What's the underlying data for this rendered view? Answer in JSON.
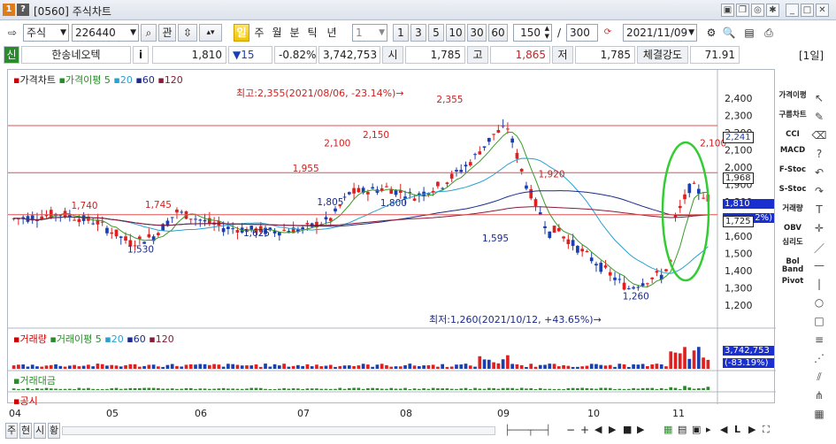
{
  "window": {
    "code": "[0560]",
    "title": "주식차트"
  },
  "titlebar_icons": [
    "pin-icon",
    "copy-icon",
    "camera-icon",
    "settings-icon",
    "minimize-icon",
    "maximize-icon",
    "close-icon"
  ],
  "toolbar": {
    "market": "주식",
    "code": "226440",
    "search_icon": "search-icon",
    "favorite_label": "관",
    "periods": [
      "일",
      "주",
      "월",
      "분",
      "틱",
      "년"
    ],
    "active_period": "일",
    "interval_value": "1",
    "interval_presets": [
      "1",
      "3",
      "5",
      "10",
      "30",
      "60"
    ],
    "count_value": "150",
    "slash": "/",
    "total_value": "300",
    "date_value": "2021/11/09"
  },
  "info": {
    "credit": "신",
    "stock_name": "한송네오텍",
    "info_icon": "i",
    "price": "1,810",
    "change": "▼15",
    "change_pct": "-0.82%",
    "volume": "3,742,753",
    "open_label": "시",
    "open": "1,785",
    "high_label": "고",
    "high": "1,865",
    "low_label": "저",
    "low": "1,785",
    "strength_label": "체결강도",
    "strength": "71.91",
    "period_badge": "[1일]"
  },
  "price_panel": {
    "title": "가격차트",
    "ma_title": "가격이평",
    "ma_periods": [
      "5",
      "20",
      "60",
      "120"
    ],
    "max_note": "최고:2,355(2021/08/06, -23.14%)→",
    "min_note": "최저:1,260(2021/10/12, +43.65%)→",
    "current_price_tag": "1,810",
    "current_pct_tag": "2%)",
    "line_tag_1": "2,241",
    "line_tag_2": "1,968",
    "line_tag_3": "1,725"
  },
  "volume_panel": {
    "title": "거래량",
    "ma_title": "거래이평",
    "ma_periods": [
      "5",
      "20",
      "60",
      "120"
    ],
    "value": "3,742,753",
    "pct": "(-83.19%)"
  },
  "amount_panel": {
    "title": "거래대금"
  },
  "notice_panel": {
    "title": "공시"
  },
  "x_axis": [
    "04",
    "05",
    "06",
    "07",
    "08",
    "09",
    "10",
    "11"
  ],
  "y_axis": [
    "2,400",
    "2,300",
    "2,200",
    "2,100",
    "2,000",
    "1,900",
    "1,800",
    "1,700",
    "1,600",
    "1,500",
    "1,400",
    "1,300",
    "1,200"
  ],
  "sidebar_indicators": [
    "가격이평",
    "구름차트",
    "CCI",
    "MACD",
    "F-Stoc",
    "S-Stoc",
    "거래량",
    "OBV",
    "심리도",
    "Bol Band",
    "Pivot"
  ],
  "bottom_tabs": [
    "주",
    "현",
    "시",
    "황"
  ],
  "chart_data": {
    "type": "candlestick",
    "annotations": [
      {
        "label": "1,740",
        "x": "04"
      },
      {
        "label": "1,745",
        "x": "05"
      },
      {
        "label": "1,530",
        "x": "05"
      },
      {
        "label": "1,625",
        "x": "06"
      },
      {
        "label": "1,955",
        "x": "07"
      },
      {
        "label": "2,100",
        "x": "07"
      },
      {
        "label": "1,805",
        "x": "07"
      },
      {
        "label": "2,150",
        "x": "07"
      },
      {
        "label": "1,800",
        "x": "08"
      },
      {
        "label": "2,355",
        "x": "08"
      },
      {
        "label": "1,595",
        "x": "08"
      },
      {
        "label": "1,920",
        "x": "09"
      },
      {
        "label": "1,260",
        "x": "10"
      },
      {
        "label": "2,100",
        "x": "11"
      }
    ],
    "ylim": [
      1150,
      2420
    ],
    "colors": {
      "up": "#e02020",
      "down": "#1a3fb0",
      "ma5": "#3a9a2a",
      "ma20": "#2aa0d0",
      "ma60": "#1a2a8a",
      "ma120": "#8a1a3a",
      "hline": "#e05050",
      "ellipse": "#33cc33"
    }
  }
}
